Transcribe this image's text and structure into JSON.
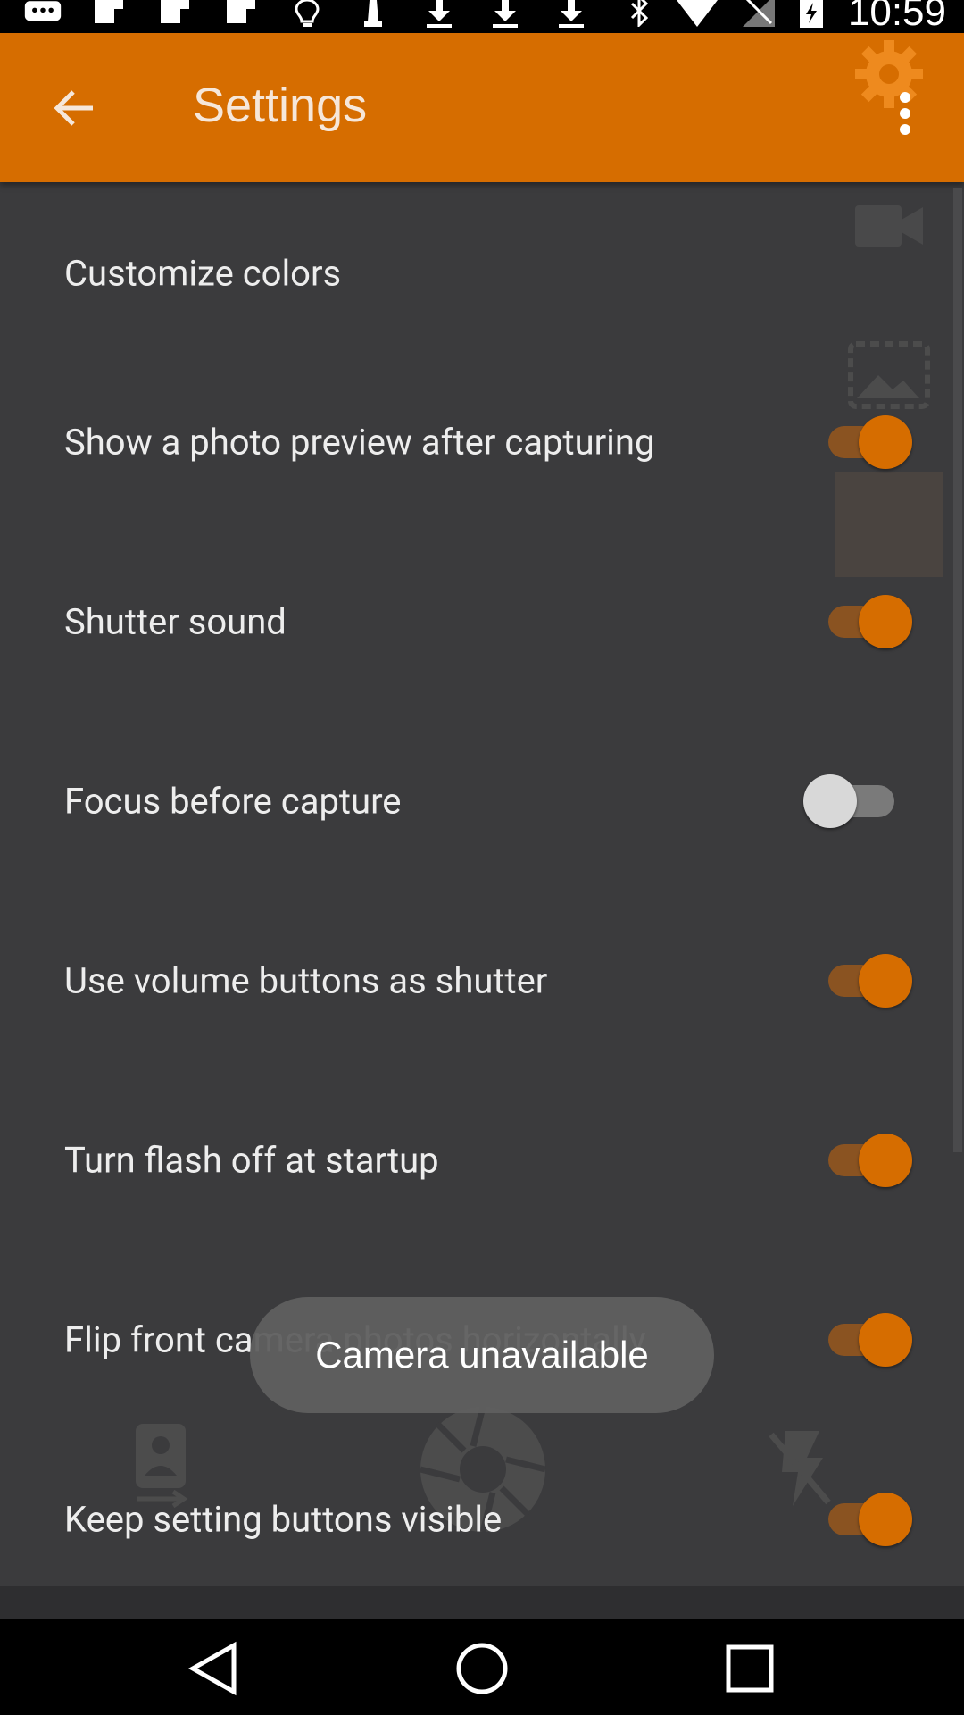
{
  "status_bar": {
    "time": "10:59",
    "left_icons": [
      "chat-icon",
      "notification-icon",
      "notification-icon",
      "notification-icon",
      "lightbulb-icon",
      "chess-icon",
      "download-icon",
      "download-icon",
      "download-icon"
    ],
    "right_icons": [
      "bluetooth-icon",
      "wifi-icon",
      "no-sim-icon",
      "battery-charging-icon"
    ]
  },
  "app_bar": {
    "title": "Settings",
    "back_icon": "arrow-left-icon",
    "overflow_icon": "more-vert-icon",
    "accent": "#d66d00"
  },
  "settings": [
    {
      "label": "Customize colors",
      "toggle": null
    },
    {
      "label": "Show a photo preview after capturing",
      "toggle": true
    },
    {
      "label": "Shutter sound",
      "toggle": true
    },
    {
      "label": "Focus before capture",
      "toggle": false
    },
    {
      "label": "Use volume buttons as shutter",
      "toggle": true
    },
    {
      "label": "Turn flash off at startup",
      "toggle": true
    },
    {
      "label": "Flip front camera photos horizontally",
      "toggle": true
    },
    {
      "label": "Keep setting buttons visible",
      "toggle": true
    }
  ],
  "toast": {
    "text": "Camera unavailable"
  },
  "nav_bar": {
    "back": "nav-back-icon",
    "home": "nav-home-icon",
    "recents": "nav-recents-icon"
  }
}
